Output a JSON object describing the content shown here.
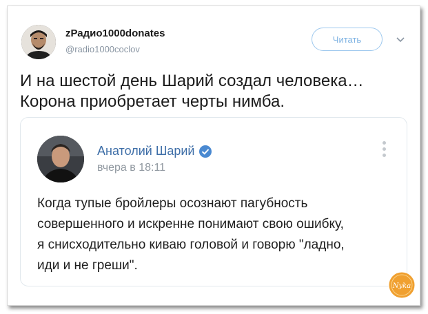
{
  "tweet": {
    "display_name": "zРадио1000donates",
    "handle": "@radio1000coclov",
    "follow_label": "Читать",
    "text_lines": [
      "И на шестой день Шарий создал человека…",
      "Корона приобретает черты нимба."
    ]
  },
  "quoted_post": {
    "author": "Анатолий Шарий",
    "time": "вчера в 18:11",
    "text_lines": [
      "Когда тупые бройлеры осознают пагубность",
      "совершенного и искренне понимают свою ошибку,",
      "я снисходительно киваю головой и говорю \"ладно,",
      "иди и не греши\"."
    ]
  },
  "watermark": {
    "text": "Nyka"
  },
  "colors": {
    "author_link": "#3f6fa8",
    "verified": "#4a89d1",
    "follow_border": "#9dc8ee",
    "watermark": "#f0a030"
  }
}
